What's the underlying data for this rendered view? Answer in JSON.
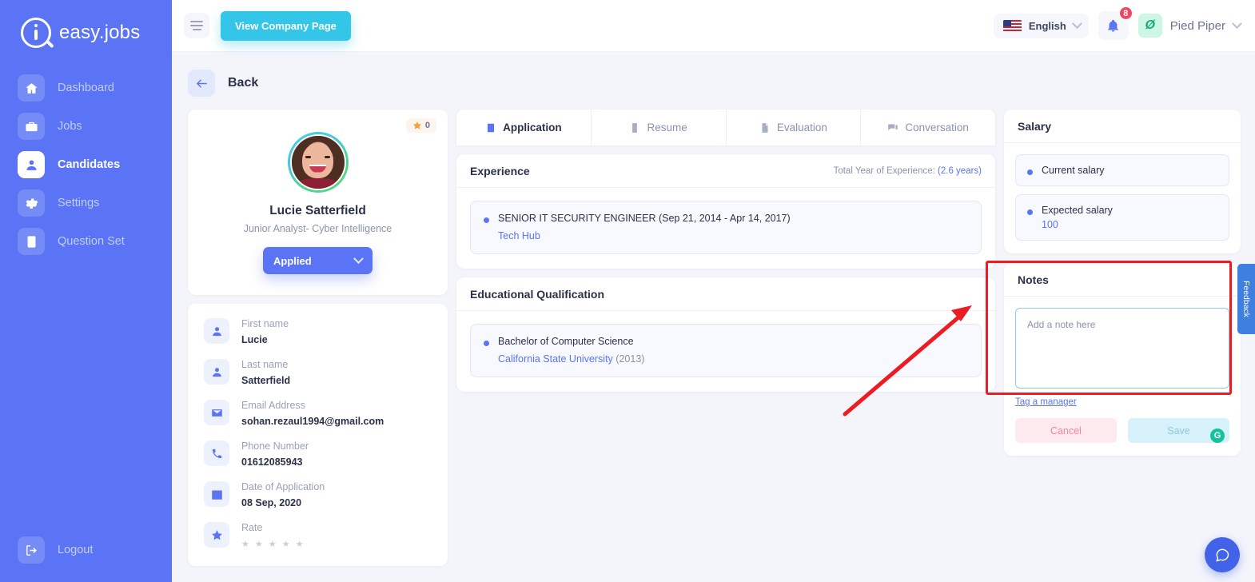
{
  "brand": {
    "name": "easy.jobs",
    "logo_icon": "magnifier-logo-icon"
  },
  "sidebar": {
    "items": [
      {
        "label": "Dashboard",
        "icon": "home-icon",
        "active": false
      },
      {
        "label": "Jobs",
        "icon": "briefcase-icon",
        "active": false
      },
      {
        "label": "Candidates",
        "icon": "user-icon",
        "active": true
      },
      {
        "label": "Settings",
        "icon": "gear-icon",
        "active": false
      },
      {
        "label": "Question Set",
        "icon": "clipboard-icon",
        "active": false
      }
    ],
    "logout": {
      "label": "Logout",
      "icon": "logout-icon"
    }
  },
  "topbar": {
    "menu_icon": "hamburger-icon",
    "company_button": "View Company Page",
    "language": {
      "value": "English",
      "flag": "us-flag-icon",
      "chevron": "chevron-down-icon"
    },
    "notifications": {
      "icon": "bell-icon",
      "count": "8"
    },
    "user": {
      "name": "Pied Piper",
      "avatar_initial": "Ø",
      "chevron": "chevron-down-icon"
    }
  },
  "back": {
    "label": "Back",
    "icon": "arrow-left-icon"
  },
  "profile": {
    "rating_badge": {
      "icon": "star-icon",
      "value": "0"
    },
    "avatar": "candidate-photo",
    "name": "Lucie Satterfield",
    "role": "Junior Analyst- Cyber Intelligence",
    "status": {
      "label": "Applied",
      "chevron": "chevron-down-icon"
    }
  },
  "details": [
    {
      "icon": "user-icon",
      "label": "First name",
      "value": "Lucie"
    },
    {
      "icon": "user-icon",
      "label": "Last name",
      "value": "Satterfield"
    },
    {
      "icon": "envelope-icon",
      "label": "Email Address",
      "value": "sohan.rezaul1994@gmail.com"
    },
    {
      "icon": "phone-icon",
      "label": "Phone Number",
      "value": "01612085943"
    },
    {
      "icon": "calendar-icon",
      "label": "Date of Application",
      "value": "08 Sep, 2020"
    },
    {
      "icon": "star-icon",
      "label": "Rate",
      "value": "",
      "stars": "★ ★ ★ ★ ★"
    }
  ],
  "tabs": [
    {
      "label": "Application",
      "icon": "application-icon",
      "active": true
    },
    {
      "label": "Resume",
      "icon": "resume-icon",
      "active": false
    },
    {
      "label": "Evaluation",
      "icon": "evaluation-icon",
      "active": false
    },
    {
      "label": "Conversation",
      "icon": "conversation-icon",
      "active": false
    }
  ],
  "experience": {
    "title": "Experience",
    "meta_label": "Total Year of Experience:",
    "meta_value": "(2.6 years)",
    "items": [
      {
        "title": "SENIOR IT SECURITY ENGINEER (Sep 21, 2014 - Apr 14, 2017)",
        "company": "Tech Hub"
      }
    ]
  },
  "education": {
    "title": "Educational Qualification",
    "items": [
      {
        "degree": "Bachelor of Computer Science",
        "school": "California State University",
        "year": "(2013)"
      }
    ]
  },
  "salary": {
    "title": "Salary",
    "items": [
      {
        "label": "Current salary",
        "value": ""
      },
      {
        "label": "Expected salary",
        "value": "100"
      }
    ]
  },
  "notes": {
    "title": "Notes",
    "placeholder": "Add a note here",
    "value": "",
    "grammarly_icon": "grammarly-icon",
    "tag_link": "Tag a manager",
    "cancel_label": "Cancel",
    "save_label": "Save"
  },
  "feedback_tab": {
    "label": "Feedback"
  },
  "chat": {
    "icon": "chat-bubble-icon"
  },
  "colors": {
    "sidebar": "#5a74f5",
    "accent": "#5a74f5",
    "cyan_button": "#34c6e8",
    "badge_red": "#f4445f",
    "annotation_red": "#ec1c24",
    "page_bg": "#f4f5fb",
    "feedback_blue": "#3f7fe0"
  }
}
